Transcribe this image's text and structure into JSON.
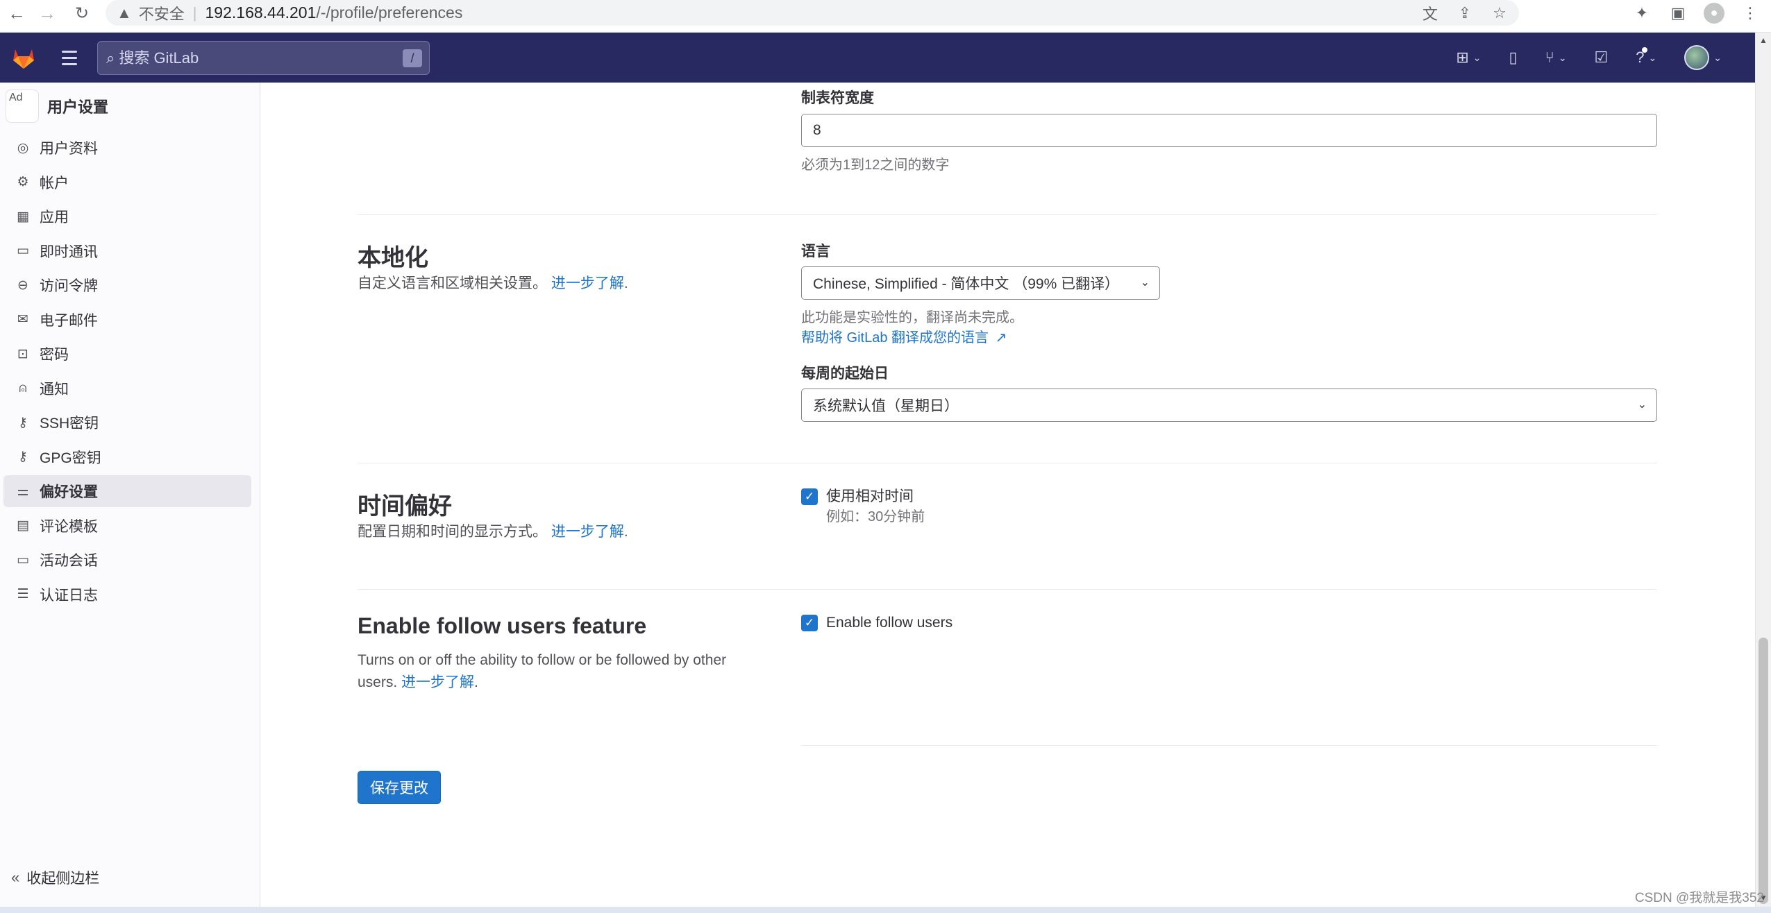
{
  "browser": {
    "insecure_label": "不安全",
    "url_host": "192.168.44.201",
    "url_path": "/-/profile/preferences"
  },
  "topnav": {
    "search_placeholder": "搜索 GitLab",
    "search_shortcut": "/"
  },
  "sidebar": {
    "avatar_text": "Ad",
    "title": "用户设置",
    "items": [
      {
        "label": "用户资料",
        "icon": "profile-icon"
      },
      {
        "label": "帐户",
        "icon": "account-icon"
      },
      {
        "label": "应用",
        "icon": "applications-icon"
      },
      {
        "label": "即时通讯",
        "icon": "chat-icon"
      },
      {
        "label": "访问令牌",
        "icon": "token-icon"
      },
      {
        "label": "电子邮件",
        "icon": "mail-icon"
      },
      {
        "label": "密码",
        "icon": "lock-icon"
      },
      {
        "label": "通知",
        "icon": "notifications-icon"
      },
      {
        "label": "SSH密钥",
        "icon": "key-icon"
      },
      {
        "label": "GPG密钥",
        "icon": "key-icon"
      },
      {
        "label": "偏好设置",
        "icon": "preferences-icon",
        "active": true
      },
      {
        "label": "评论模板",
        "icon": "comment-icon"
      },
      {
        "label": "活动会话",
        "icon": "monitor-icon"
      },
      {
        "label": "认证日志",
        "icon": "log-icon"
      }
    ],
    "collapse_label": "收起侧边栏"
  },
  "tab_width": {
    "label": "制表符宽度",
    "value": "8",
    "help": "必须为1到12之间的数字"
  },
  "localization": {
    "title": "本地化",
    "description": "自定义语言和区域相关设置。",
    "learn_more": "进一步了解",
    "language_label": "语言",
    "language_value": "Chinese, Simplified - 简体中文 （99% 已翻译）",
    "language_help": "此功能是实验性的，翻译尚未完成。",
    "translate_link": "帮助将 GitLab 翻译成您的语言",
    "first_day_label": "每周的起始日",
    "first_day_value": "系统默认值（星期日）"
  },
  "time_preferences": {
    "title": "时间偏好",
    "description": "配置日期和时间的显示方式。",
    "learn_more": "进一步了解",
    "relative_time_label": "使用相对时间",
    "relative_time_checked": true,
    "relative_time_help": "例如：30分钟前"
  },
  "follow_users": {
    "title": "Enable follow users feature",
    "description_line1": "Turns on or off the ability to follow or be followed by other",
    "description_line2": "users.",
    "learn_more": "进一步了解",
    "checkbox_label": "Enable follow users",
    "checkbox_checked": true
  },
  "save_button": "保存更改",
  "watermark": "CSDN @我就是我352"
}
